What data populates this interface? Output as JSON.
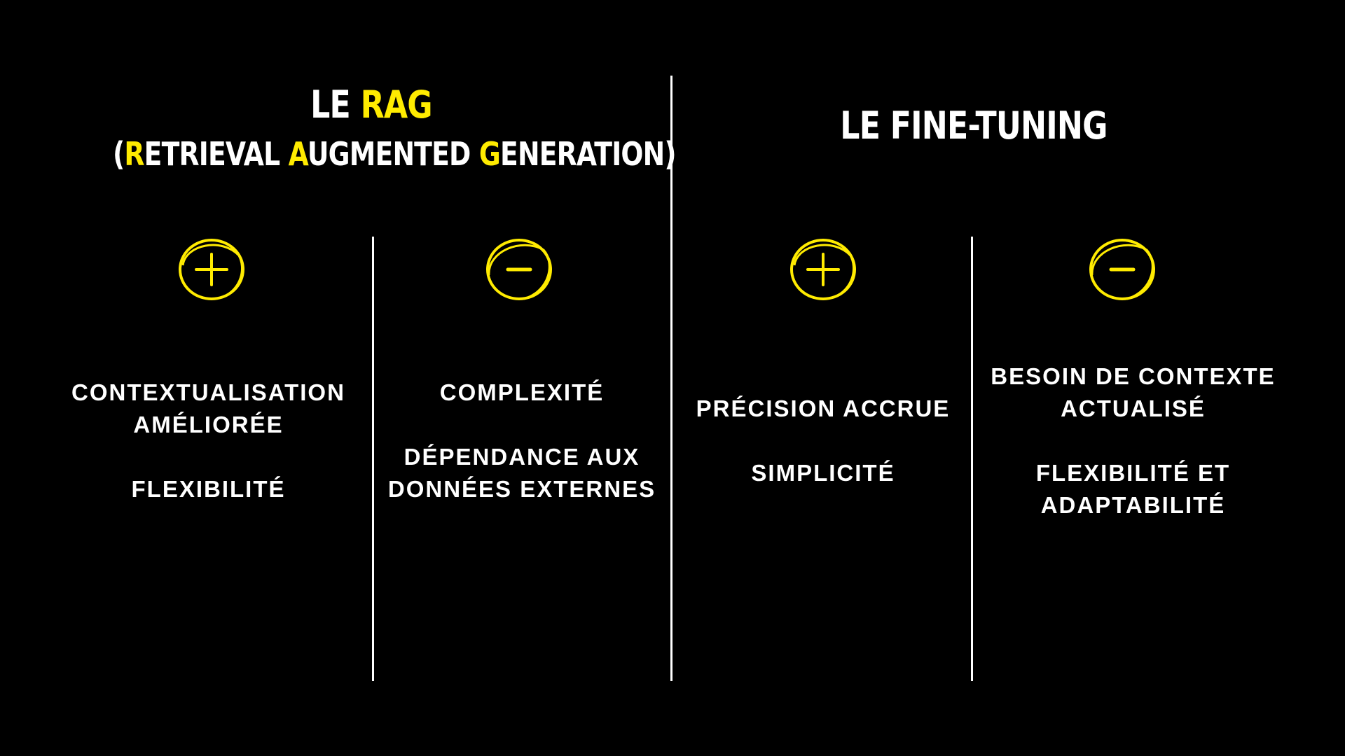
{
  "rag": {
    "title_prefix": "LE ",
    "title_highlight": "RAG",
    "subtitle": {
      "open": "(",
      "r": "R",
      "r_rest": "ETRIEVAL ",
      "a": "A",
      "a_rest": "UGMENTED ",
      "g": "G",
      "g_rest": "ENERATION)"
    },
    "pros_icon": "plus-circle-icon",
    "cons_icon": "minus-circle-icon",
    "pros": [
      "CONTEXTUALISATION AMÉLIORÉE",
      "FLEXIBILITÉ"
    ],
    "cons": [
      "COMPLEXITÉ",
      "DÉPENDANCE AUX DONNÉES EXTERNES"
    ]
  },
  "fine_tuning": {
    "title": "LE FINE-TUNING",
    "pros_icon": "plus-circle-icon",
    "cons_icon": "minus-circle-icon",
    "pros": [
      "PRÉCISION ACCRUE",
      "SIMPLICITÉ"
    ],
    "cons": [
      "BESOIN DE CONTEXTE ACTUALISÉ",
      "FLEXIBILITÉ ET ADAPTABILITÉ"
    ]
  },
  "colors": {
    "background": "#000000",
    "text": "#ffffff",
    "highlight": "#ffeb00"
  }
}
